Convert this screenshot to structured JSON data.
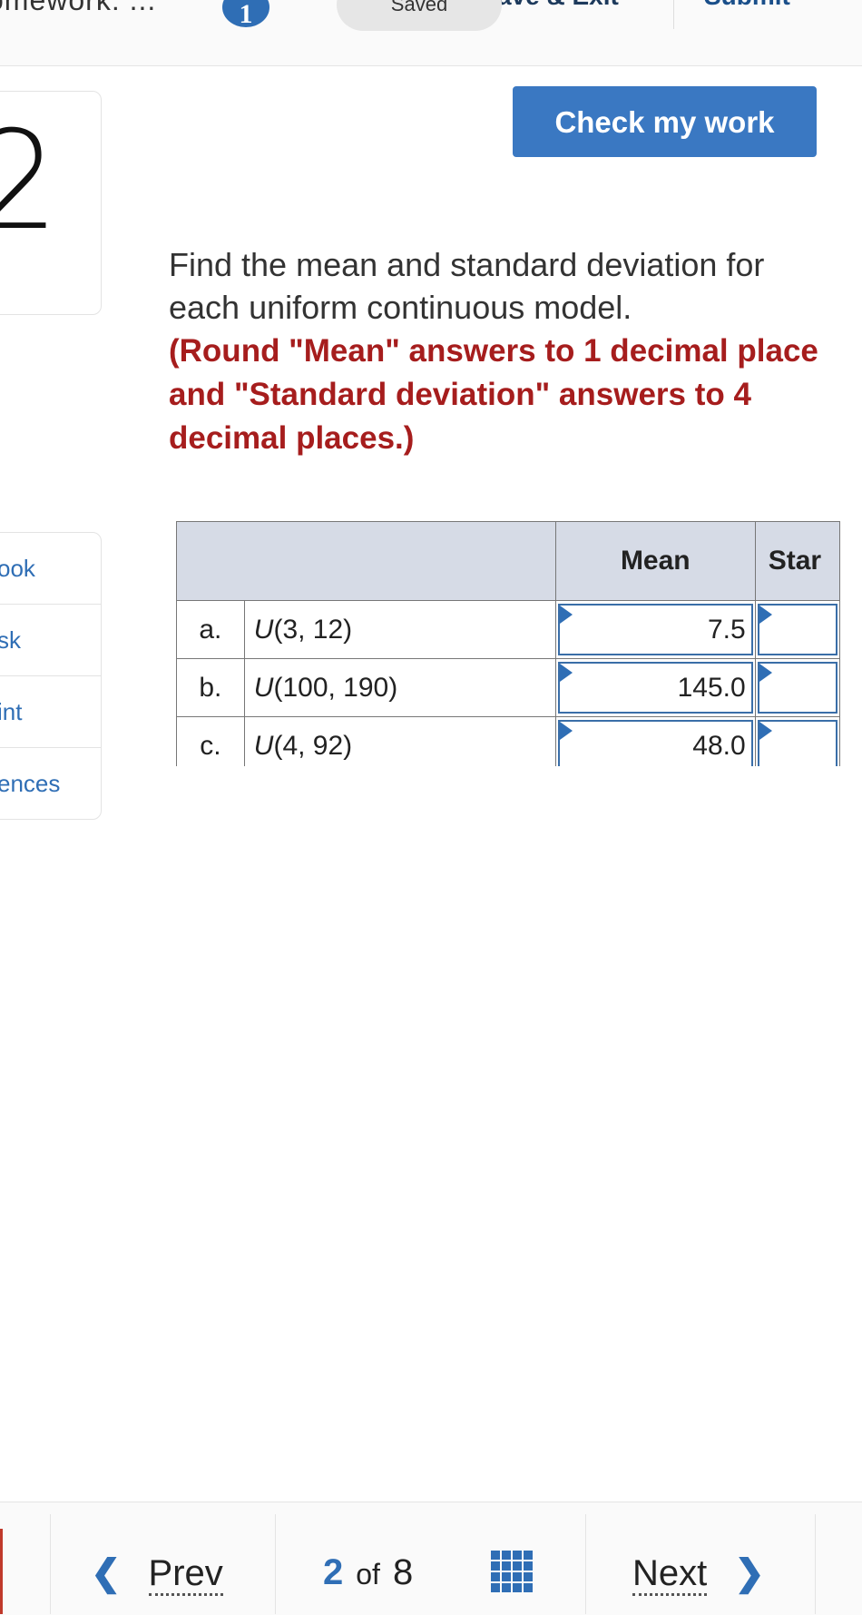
{
  "header": {
    "title": "omework: ...",
    "info_badge": "1",
    "saved_label": "Saved",
    "save_exit_label": "ave & Exit",
    "submit_label": "Submit"
  },
  "question": {
    "number": "2",
    "check_label": "Check my work",
    "prompt": "Find the mean and standard deviation for each uniform continuous model.",
    "instruction": "(Round \"Mean\" answers to 1 decimal place and \"Standard deviation\" answers to 4 decimal places.)"
  },
  "tools": [
    "ook",
    "sk",
    "int",
    "ences"
  ],
  "table": {
    "headers": {
      "mean": "Mean",
      "sd": "Star"
    },
    "rows": [
      {
        "letter": "a.",
        "fn": "U",
        "args": "(3, 12)",
        "mean": "7.5",
        "sd": ""
      },
      {
        "letter": "b.",
        "fn": "U",
        "args": "(100, 190)",
        "mean": "145.0",
        "sd": ""
      },
      {
        "letter": "c.",
        "fn": "U",
        "args": "(4, 92)",
        "mean": "48.0",
        "sd": ""
      }
    ]
  },
  "nav": {
    "prev_label": "Prev",
    "current_page": "2",
    "of_label": "of",
    "total_pages": "8",
    "next_label": "Next"
  },
  "colors": {
    "accent": "#3a78c2",
    "instruction_red": "#a61d1d",
    "header_bg": "#d6dbe6"
  }
}
